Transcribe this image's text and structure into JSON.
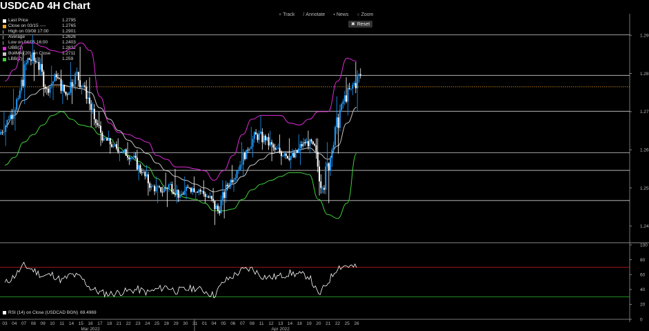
{
  "title": "USDCAD 4H Chart",
  "toolbar": [
    {
      "label": "Track",
      "icon": "crosshair-icon",
      "glyph": "+"
    },
    {
      "label": "Annotate",
      "icon": "pencil-icon",
      "glyph": "/"
    },
    {
      "label": "News",
      "icon": "news-icon",
      "glyph": "▪"
    },
    {
      "label": "Zoom",
      "icon": "magnifier-icon",
      "glyph": "○"
    }
  ],
  "reset_label": "Reset",
  "legend": [
    {
      "label": "Last Price",
      "value": "1.2795",
      "color": "#ffffff",
      "marker": "square"
    },
    {
      "label": "Close on 03/15 ----",
      "value": "1.2765",
      "color": "#f5a623",
      "marker": "square"
    },
    {
      "label": "High on 03/08 17:00",
      "value": "1.2901",
      "color": "#aaaaaa",
      "marker": "tick"
    },
    {
      "label": "Average",
      "value": "1.2626",
      "color": "#aaaaaa",
      "marker": "tick"
    },
    {
      "label": "Low on 04/05 16:00",
      "value": "1.2403",
      "color": "#aaaaaa",
      "marker": "tick"
    },
    {
      "label": "UBB(2)",
      "value": "1.2832",
      "color": "#e02ad8",
      "marker": "square"
    },
    {
      "label": "BollMA (20)  on Close",
      "value": "1.2711",
      "color": "#c8c8c8",
      "marker": "square"
    },
    {
      "label": "LBB(2)",
      "value": "1.259",
      "color": "#3fd13a",
      "marker": "square"
    }
  ],
  "rsi_legend": {
    "label": "RSI (14)  on Close (USDCAD BGN)",
    "value": "69.4969",
    "color": "#ffffff"
  },
  "colors": {
    "up_candle": "#1f9cff",
    "down_candle": "#ffffff",
    "ubb": "#e02ad8",
    "ma": "#c8c8c8",
    "lbb": "#3fd13a",
    "close_ref": "#f5a623",
    "rsi": "#ffffff",
    "rsi_upper": "#d01c1c",
    "rsi_lower": "#2ec02e"
  },
  "chart_data": {
    "type": "candlestick",
    "title": "USDCAD 4H Chart",
    "price_axis": {
      "ticks": [
        "1.29",
        "1.28",
        "1.27",
        "1.26",
        "1.25",
        "1.24"
      ],
      "range": [
        1.236,
        1.296
      ]
    },
    "rsi_axis": {
      "ticks": [
        "100",
        "80",
        "60",
        "40",
        "20",
        "0"
      ],
      "range": [
        0,
        100
      ]
    },
    "reference_lines": {
      "high": 1.2901,
      "last": 1.2795,
      "close_03_15": 1.2765,
      "levels": [
        1.2701,
        1.2592,
        1.2546,
        1.2467
      ]
    },
    "rsi_levels": [
      70,
      30
    ],
    "x_ticks": [
      "03",
      "04",
      "07",
      "08",
      "09",
      "10",
      "11",
      "14",
      "15",
      "16",
      "17",
      "18",
      "21",
      "22",
      "23",
      "24",
      "25",
      "28",
      "29",
      "30",
      "31",
      "01",
      "04",
      "05",
      "06",
      "07",
      "08",
      "11",
      "12",
      "13",
      "14",
      "18",
      "19",
      "20",
      "21",
      "22",
      "25",
      "26"
    ],
    "month_labels": [
      {
        "label": "Mar 2022",
        "at_tick": "16"
      },
      {
        "label": "Apr 2022",
        "at_tick": "13"
      }
    ],
    "daily_ohlc": [
      [
        1.264,
        1.27,
        1.261,
        1.268
      ],
      [
        1.268,
        1.276,
        1.265,
        1.2735
      ],
      [
        1.2735,
        1.286,
        1.272,
        1.284
      ],
      [
        1.284,
        1.2901,
        1.278,
        1.283
      ],
      [
        1.283,
        1.285,
        1.274,
        1.276
      ],
      [
        1.276,
        1.282,
        1.273,
        1.279
      ],
      [
        1.279,
        1.281,
        1.272,
        1.2745
      ],
      [
        1.2745,
        1.283,
        1.272,
        1.28
      ],
      [
        1.28,
        1.287,
        1.2745,
        1.2765
      ],
      [
        1.2765,
        1.279,
        1.266,
        1.268
      ],
      [
        1.268,
        1.27,
        1.261,
        1.263
      ],
      [
        1.263,
        1.265,
        1.259,
        1.261
      ],
      [
        1.261,
        1.263,
        1.257,
        1.2595
      ],
      [
        1.2595,
        1.262,
        1.256,
        1.258
      ],
      [
        1.258,
        1.26,
        1.252,
        1.254
      ],
      [
        1.254,
        1.256,
        1.248,
        1.2505
      ],
      [
        1.2505,
        1.253,
        1.246,
        1.249
      ],
      [
        1.249,
        1.254,
        1.245,
        1.251
      ],
      [
        1.251,
        1.255,
        1.246,
        1.248
      ],
      [
        1.248,
        1.253,
        1.247,
        1.25
      ],
      [
        1.25,
        1.253,
        1.247,
        1.2495
      ],
      [
        1.2495,
        1.252,
        1.246,
        1.2475
      ],
      [
        1.2475,
        1.25,
        1.2403,
        1.244
      ],
      [
        1.244,
        1.252,
        1.242,
        1.2505
      ],
      [
        1.2505,
        1.256,
        1.249,
        1.2545
      ],
      [
        1.2545,
        1.262,
        1.253,
        1.26
      ],
      [
        1.26,
        1.266,
        1.258,
        1.264
      ],
      [
        1.264,
        1.269,
        1.26,
        1.2625
      ],
      [
        1.2625,
        1.265,
        1.257,
        1.26
      ],
      [
        1.26,
        1.264,
        1.256,
        1.259
      ],
      [
        1.259,
        1.263,
        1.255,
        1.258
      ],
      [
        1.258,
        1.264,
        1.256,
        1.262
      ],
      [
        1.262,
        1.265,
        1.259,
        1.2615
      ],
      [
        1.2615,
        1.263,
        1.248,
        1.25
      ],
      [
        1.25,
        1.262,
        1.246,
        1.26
      ],
      [
        1.26,
        1.274,
        1.259,
        1.272
      ],
      [
        1.272,
        1.279,
        1.269,
        1.276
      ],
      [
        1.276,
        1.283,
        1.27,
        1.2795
      ]
    ],
    "series": [
      {
        "name": "UBB(2)",
        "values": [
          1.278,
          1.281,
          1.288,
          1.288,
          1.287,
          1.286,
          1.2855,
          1.2865,
          1.288,
          1.286,
          1.274,
          1.267,
          1.2645,
          1.264,
          1.263,
          1.262,
          1.2585,
          1.2575,
          1.2555,
          1.2555,
          1.255,
          1.2545,
          1.252,
          1.2545,
          1.2585,
          1.264,
          1.268,
          1.269,
          1.269,
          1.269,
          1.267,
          1.2665,
          1.268,
          1.27,
          1.27,
          1.278,
          1.284,
          1.2832
        ]
      },
      {
        "name": "BollMA (20)  on Close",
        "values": [
          1.266,
          1.269,
          1.273,
          1.2745,
          1.276,
          1.277,
          1.277,
          1.2765,
          1.276,
          1.275,
          1.271,
          1.268,
          1.265,
          1.2625,
          1.2605,
          1.259,
          1.2565,
          1.2545,
          1.253,
          1.252,
          1.251,
          1.25,
          1.249,
          1.2495,
          1.251,
          1.253,
          1.256,
          1.2575,
          1.259,
          1.2595,
          1.2595,
          1.26,
          1.2605,
          1.259,
          1.2575,
          1.261,
          1.267,
          1.2711
        ]
      },
      {
        "name": "LBB(2)",
        "values": [
          1.256,
          1.258,
          1.262,
          1.264,
          1.2665,
          1.269,
          1.27,
          1.268,
          1.2665,
          1.266,
          1.264,
          1.263,
          1.2605,
          1.2585,
          1.257,
          1.2555,
          1.2525,
          1.25,
          1.2485,
          1.2475,
          1.247,
          1.246,
          1.244,
          1.244,
          1.2445,
          1.247,
          1.2495,
          1.251,
          1.252,
          1.253,
          1.254,
          1.254,
          1.2535,
          1.247,
          1.243,
          1.242,
          1.246,
          1.259
        ]
      },
      {
        "name": "RSI (14)  on Close (USDCAD BGN)",
        "values": [
          48,
          58,
          72,
          66,
          58,
          60,
          52,
          60,
          56,
          42,
          36,
          34,
          36,
          38,
          40,
          36,
          40,
          44,
          38,
          40,
          42,
          38,
          32,
          50,
          58,
          66,
          68,
          58,
          56,
          58,
          62,
          60,
          58,
          32,
          50,
          70,
          72,
          69.4969
        ]
      }
    ]
  }
}
